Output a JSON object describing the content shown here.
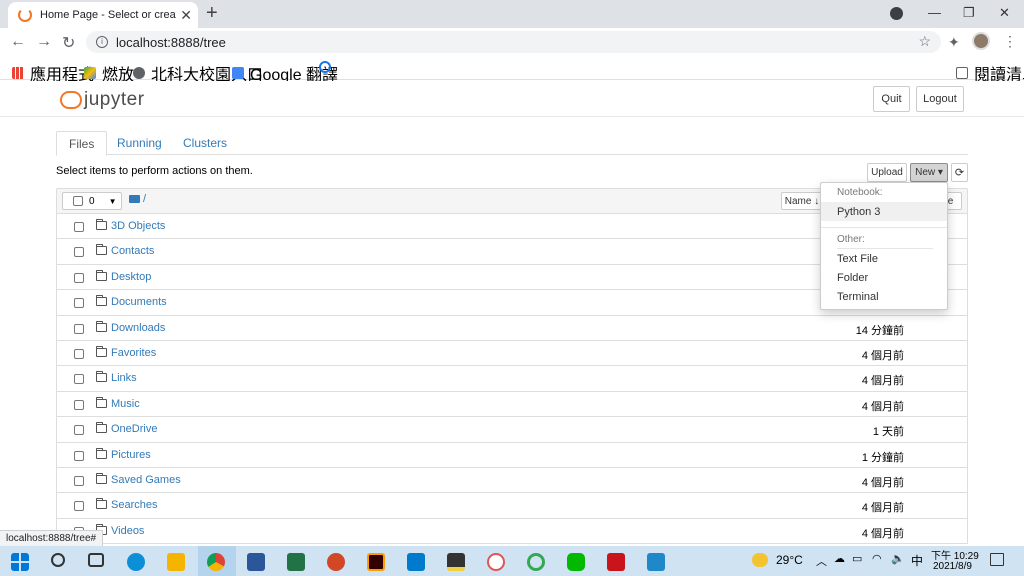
{
  "browser": {
    "tab_title": "Home Page - Select or create a",
    "tab_close": "✕",
    "new_tab": "+",
    "window_controls": [
      "—",
      "❐",
      "✕"
    ],
    "url": "localhost:8888/tree",
    "bookmarks": [
      {
        "label": "應用程式",
        "icon": "apps-grid-icon",
        "color": "#ea4335"
      },
      {
        "label": "燃放",
        "icon": "google-drive-icon",
        "color": "#34a853"
      },
      {
        "label": "北科大校園入口",
        "icon": "globe-icon",
        "color": "#5f6368"
      },
      {
        "label": "Google 翻譯",
        "icon": "google-translate-icon",
        "color": "#4285f4"
      },
      {
        "label": "",
        "icon": "fingerprint-icon",
        "color": "#1a73e8"
      }
    ],
    "reading_list": "閱讀清單",
    "status_url": "localhost:8888/tree#"
  },
  "jupyter": {
    "logo_text": "jupyter",
    "quit": "Quit",
    "logout": "Logout",
    "tabs": [
      "Files",
      "Running",
      "Clusters"
    ],
    "active_tab": "Files",
    "hint": "Select items to perform actions on them.",
    "upload": "Upload",
    "new": "New ▾",
    "refresh": "⟳",
    "selected_count": "0",
    "breadcrumb": "/",
    "sort_name": "Name ↓",
    "sort_tail": "e",
    "dropdown": {
      "notebook_header": "Notebook:",
      "python3": "Python 3",
      "other_header": "Other:",
      "text_file": "Text File",
      "folder": "Folder",
      "terminal": "Terminal"
    },
    "files": [
      {
        "name": "3D Objects",
        "time": ""
      },
      {
        "name": "Contacts",
        "time": ""
      },
      {
        "name": "Desktop",
        "time": ""
      },
      {
        "name": "Documents",
        "time": ""
      },
      {
        "name": "Downloads",
        "time": "14 分鐘前"
      },
      {
        "name": "Favorites",
        "time": "4 個月前"
      },
      {
        "name": "Links",
        "time": "4 個月前"
      },
      {
        "name": "Music",
        "time": "4 個月前"
      },
      {
        "name": "OneDrive",
        "time": "1 天前"
      },
      {
        "name": "Pictures",
        "time": "1 分鐘前"
      },
      {
        "name": "Saved Games",
        "time": "4 個月前"
      },
      {
        "name": "Searches",
        "time": "4 個月前"
      },
      {
        "name": "Videos",
        "time": "4 個月前"
      }
    ]
  },
  "taskbar": {
    "weather": "29°C",
    "ime": "中",
    "time": "下午 10:29",
    "date": "2021/8/9",
    "apps": [
      {
        "icon": "windows-start-icon",
        "color": "#0078d7"
      },
      {
        "icon": "search-icon",
        "color": "#333333"
      },
      {
        "icon": "task-view-icon",
        "color": "#333333"
      },
      {
        "icon": "edge-icon",
        "color": "#0c8fd6"
      },
      {
        "icon": "file-explorer-icon",
        "color": "#f4b400"
      },
      {
        "icon": "chrome-icon",
        "color": "#db4437"
      },
      {
        "icon": "word-icon",
        "color": "#2b579a"
      },
      {
        "icon": "excel-icon",
        "color": "#217346"
      },
      {
        "icon": "powerpoint-icon",
        "color": "#d24726"
      },
      {
        "icon": "illustrator-icon",
        "color": "#ff9a00"
      },
      {
        "icon": "vscode-icon",
        "color": "#007acc"
      },
      {
        "icon": "sticky-app-icon",
        "color": "#333333"
      },
      {
        "icon": "paint-app-icon",
        "color": "#e05555"
      },
      {
        "icon": "green-ring-app-icon",
        "color": "#34a853"
      },
      {
        "icon": "line-icon",
        "color": "#00b900"
      },
      {
        "icon": "acrobat-icon",
        "color": "#c9141b"
      },
      {
        "icon": "photos-icon",
        "color": "#1e88c8"
      }
    ]
  }
}
